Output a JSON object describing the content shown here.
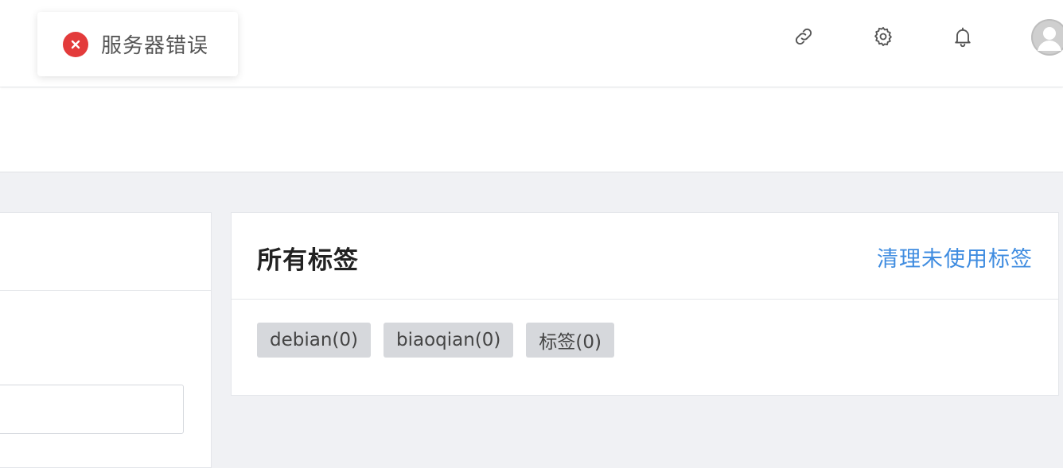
{
  "toast": {
    "message": "服务器错误",
    "icon": "error-circle-icon",
    "color": "#e33b3b"
  },
  "header": {
    "icons": [
      "link-icon",
      "gear-icon",
      "bell-icon",
      "avatar"
    ]
  },
  "tag_card": {
    "title": "所有标签",
    "action_label": "清理未使用标签",
    "tags": [
      {
        "label": "debian(0)"
      },
      {
        "label": "biaoqian(0)"
      },
      {
        "label": "标签(0)"
      }
    ]
  },
  "colors": {
    "accent": "#3f8ce0",
    "error": "#e33b3b",
    "tag_bg": "#d6d8dc",
    "page_bg": "#f0f1f4"
  }
}
